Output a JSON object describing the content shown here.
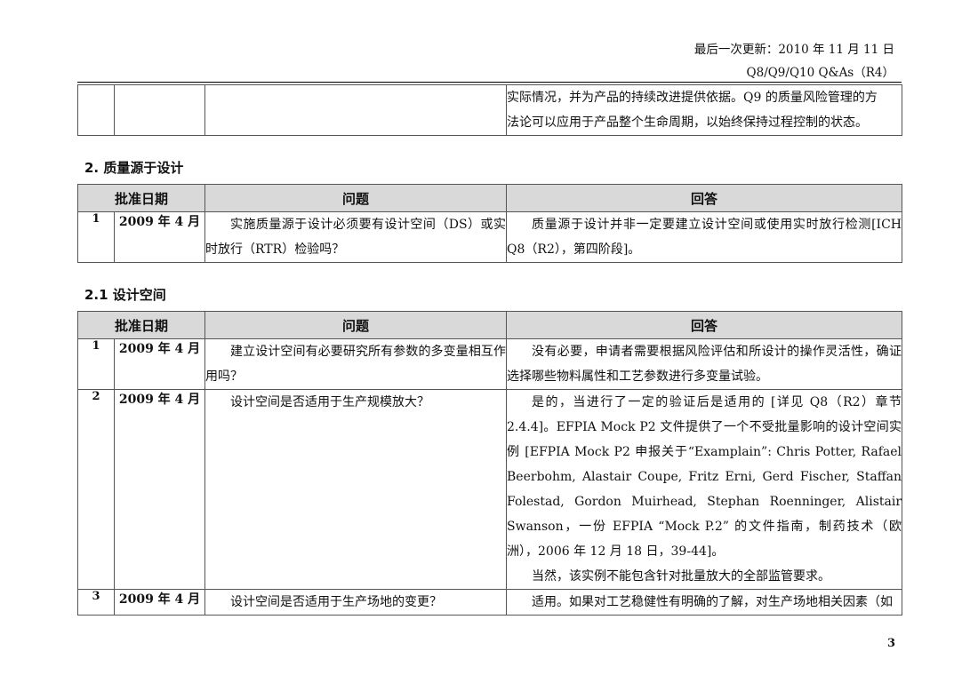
{
  "header": {
    "last_updated": "最后一次更新：2010 年 11 月 11 日",
    "doc_title": "Q8/Q9/Q10 Q&As（R4）"
  },
  "continued_row": {
    "answer_lines": [
      "实际情况，并为产品的持续改进提供依据。Q9 的质量风险管理的方",
      "法论可以应用于产品整个生命周期，以始终保持过程控制的状态。"
    ]
  },
  "section1": {
    "heading": "2.  质量源于设计",
    "columns": [
      "批准日期",
      "问题",
      "回答"
    ],
    "rows": [
      {
        "num": "1",
        "date": "2009 年 4 月",
        "question": "实施质量源于设计必须要有设计空间（DS）或实时放行（RTR）检验吗？",
        "answer": "质量源于设计并非一定要建立设计空间或使用实时放行检测[ICH Q8（R2），第四阶段]。"
      }
    ]
  },
  "section2": {
    "heading": "2.1  设计空间",
    "columns": [
      "批准日期",
      "问题",
      "回答"
    ],
    "rows": [
      {
        "num": "1",
        "date": "2009 年 4 月",
        "question": "建立设计空间有必要研究所有参数的多变量相互作用吗？",
        "answer": "没有必要，申请者需要根据风险评估和所设计的操作灵活性，确证选择哪些物料属性和工艺参数进行多变量试验。"
      },
      {
        "num": "2",
        "date": "2009 年 4 月",
        "question": "设计空间是否适用于生产规模放大？",
        "answer": "是的，当进行了一定的验证后是适用的 [详见 Q8（R2）章节 2.4.4]。EFPIA Mock P2 文件提供了一个不受批量影响的设计空间实例 [EFPIA Mock P2 申报关于“Examplain”: Chris Potter, Rafael Beerbohm, Alastair Coupe, Fritz Erni, Gerd Fischer, Staffan Folestad, Gordon Muirhead, Stephan Roenninger, Alistair Swanson，一份 EFPIA “Mock P.2” 的文件指南，制药技术（欧洲），2006 年 12 月 18 日，39-44]。",
        "answer_note": "当然，该实例不能包含针对批量放大的全部监管要求。"
      },
      {
        "num": "3",
        "date": "2009 年 4 月",
        "question": "设计空间是否适用于生产场地的变更？",
        "answer": "适用。如果对工艺稳健性有明确的了解，对生产场地相关因素（如"
      }
    ]
  },
  "page_number": "3"
}
